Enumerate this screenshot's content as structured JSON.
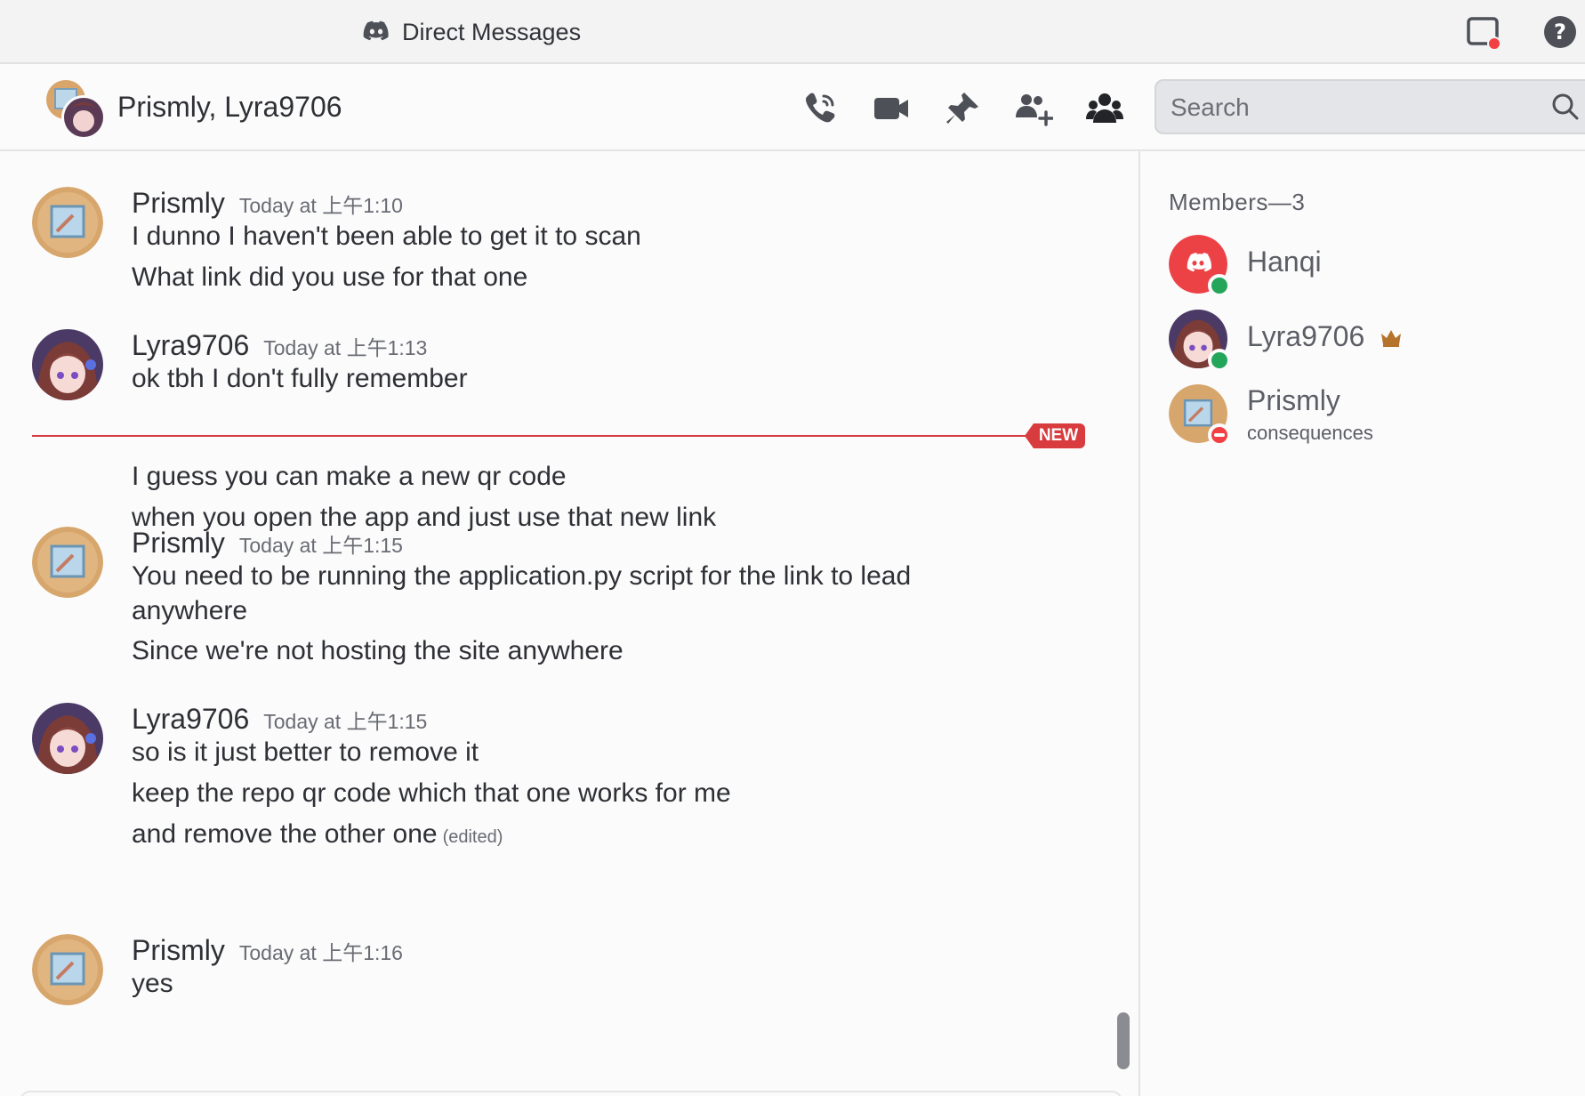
{
  "titlebar": {
    "title": "Direct Messages"
  },
  "header": {
    "title": "Prismly, Lyra9706"
  },
  "search": {
    "placeholder": "Search"
  },
  "chat": {
    "new_badge": "NEW",
    "messages": [
      {
        "author": "Prismly",
        "timestamp": "Today at 上午1:10",
        "lines": [
          "I dunno I haven't been able to get it to scan",
          "What link did you use for that one"
        ]
      },
      {
        "author": "Lyra9706",
        "timestamp": "Today at 上午1:13",
        "lines": [
          "ok tbh I don't fully remember",
          "I guess you can make a new qr code",
          "when you open the app and just use that new link"
        ]
      },
      {
        "author": "Prismly",
        "timestamp": "Today at 上午1:15",
        "lines": [
          "You need to be running the application.py script for the link to lead",
          "anywhere",
          "Since we're not hosting the site anywhere"
        ]
      },
      {
        "author": "Lyra9706",
        "timestamp": "Today at 上午1:15",
        "lines": [
          "so is it just better to remove it",
          "keep the repo qr code which that one works for me",
          "and remove the other one"
        ],
        "edited_label": "(edited)"
      },
      {
        "author": "Prismly",
        "timestamp": "Today at 上午1:16",
        "lines": [
          "yes"
        ]
      }
    ]
  },
  "members": {
    "heading": "Members—3",
    "list": [
      {
        "name": "Hanqi",
        "status": "online",
        "status_color": "#23a55a"
      },
      {
        "name": "Lyra9706",
        "status": "online",
        "status_color": "#23a55a",
        "owner": true
      },
      {
        "name": "Prismly",
        "status": "dnd",
        "status_color": "#f23f43",
        "custom_status": "consequences"
      }
    ]
  },
  "colors": {
    "accent_red": "#d83c3e",
    "discord_red": "#ed4245",
    "online": "#23a55a"
  }
}
